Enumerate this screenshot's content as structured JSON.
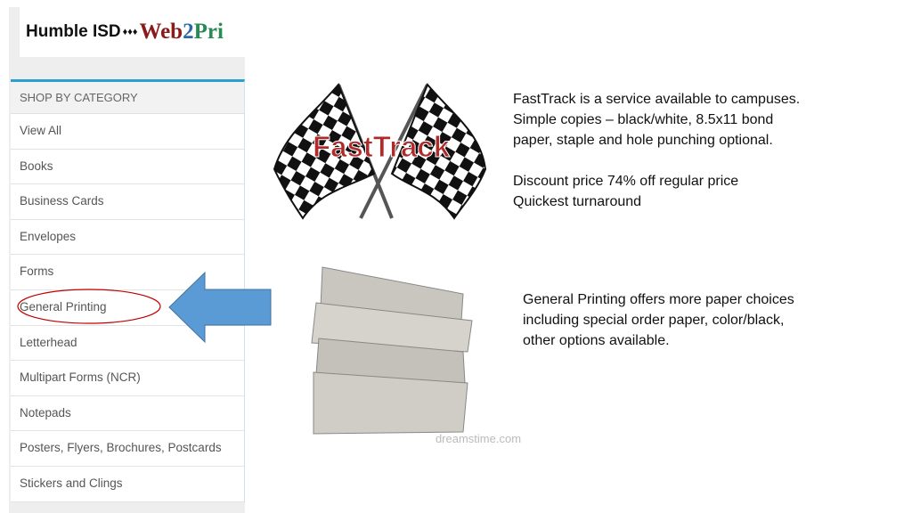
{
  "logo": {
    "text_a": "Humble ISD",
    "diamonds": "♦♦♦",
    "web": "Web",
    "two": "2",
    "pri": "Pri"
  },
  "menu": {
    "header": "SHOP BY CATEGORY",
    "items": [
      "View All",
      "Books",
      "Business Cards",
      "Envelopes",
      "Forms",
      "General Printing",
      "Letterhead",
      "Multipart Forms (NCR)",
      "Notepads",
      "Posters, Flyers, Brochures, Postcards",
      "Stickers and Clings"
    ],
    "highlighted": "General Printing"
  },
  "fasttrack": {
    "logo_text": "FastTrack",
    "lines": [
      "FastTrack is a service available to campuses.",
      "Simple copies – black/white, 8.5x11 bond",
      "paper, staple and hole punching optional.",
      "",
      "Discount price 74% off regular price",
      "Quickest turnaround"
    ]
  },
  "general": {
    "lines": [
      "General Printing offers more paper choices",
      "including special order paper, color/black,",
      "other options available."
    ],
    "watermark": "dreamstime.com"
  },
  "colors": {
    "arrow": "#5b9bd5",
    "circle": "#c00000",
    "accent": "#2aa0d0"
  }
}
